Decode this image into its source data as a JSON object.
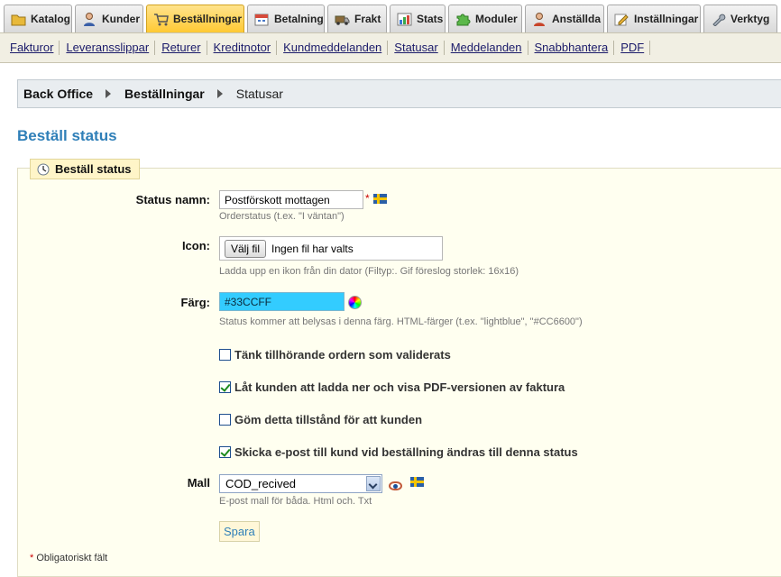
{
  "tabs": [
    {
      "label": "Katalog",
      "icon": "folder-icon",
      "active": false
    },
    {
      "label": "Kunder",
      "icon": "person-icon",
      "active": false
    },
    {
      "label": "Beställningar",
      "icon": "cart-icon",
      "active": true
    },
    {
      "label": "Betalning",
      "icon": "calendar-icon",
      "active": false
    },
    {
      "label": "Frakt",
      "icon": "truck-icon",
      "active": false
    },
    {
      "label": "Stats",
      "icon": "chart-icon",
      "active": false
    },
    {
      "label": "Moduler",
      "icon": "puzzle-icon",
      "active": false
    },
    {
      "label": "Anställda",
      "icon": "employee-icon",
      "active": false
    },
    {
      "label": "Inställningar",
      "icon": "settings-icon",
      "active": false
    },
    {
      "label": "Verktyg",
      "icon": "wrench-icon",
      "active": false
    }
  ],
  "submenu": [
    "Fakturor",
    "Leveransslippar",
    "Returer",
    "Kreditnotor",
    "Kundmeddelanden",
    "Statusar",
    "Meddelanden",
    "Snabbhantera",
    "PDF"
  ],
  "breadcrumb": {
    "root": "Back Office",
    "section": "Beställningar",
    "current": "Statusar"
  },
  "page_title": "Beställ status",
  "form": {
    "legend": "Beställ status",
    "status_name": {
      "label": "Status namn:",
      "value": "Postförskott mottagen",
      "required_mark": "*",
      "hint": "Orderstatus (t.ex. \"I väntan\")"
    },
    "icon": {
      "label": "Icon:",
      "button": "Välj fil",
      "no_file": "Ingen fil har valts",
      "hint": "Ladda upp en ikon från din dator (Filtyp:. Gif föreslog storlek: 16x16)"
    },
    "color": {
      "label": "Färg:",
      "value": "#33CCFF",
      "swatch": "#33ccff",
      "hint": "Status kommer att belysas i denna färg. HTML-färger (t.ex. \"lightblue\", \"#CC6600\")"
    },
    "checkboxes": [
      {
        "label": "Tänk tillhörande ordern som validerats",
        "checked": false
      },
      {
        "label": "Låt kunden att ladda ner och visa PDF-versionen av faktura",
        "checked": true
      },
      {
        "label": "Göm detta tillstånd för att kunden",
        "checked": false
      },
      {
        "label": "Skicka e-post till kund vid beställning ändras till denna status",
        "checked": true
      }
    ],
    "template": {
      "label": "Mall",
      "value": "COD_recived",
      "hint": "E-post mall för båda. Html och. Txt"
    },
    "save": "Spara",
    "footnote_star": "*",
    "footnote": "Obligatoriskt fält"
  },
  "colors": {
    "accent": "#2f7fb8",
    "active_tab": "#ffc933",
    "panel_bg": "#fffff0"
  }
}
